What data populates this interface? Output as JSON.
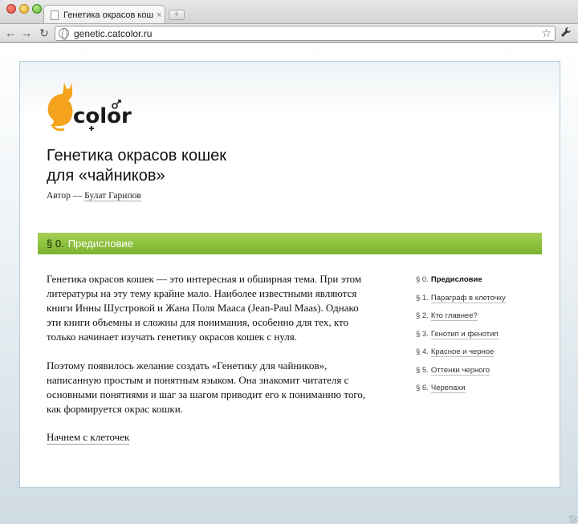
{
  "browser": {
    "tab_title": "Генетика окрасов кошек для «чайников»",
    "tab_close": "×",
    "new_tab": "+",
    "url": "genetic.catcolor.ru",
    "back_glyph": "←",
    "forward_glyph": "→",
    "reload_glyph": "↻",
    "star_glyph": "☆",
    "wrench_glyph": "🔧"
  },
  "site": {
    "logo_text": "color",
    "title_line1": "Генетика окрасов кошек",
    "title_line2": "для «чайников»",
    "author_prefix": "Автор — ",
    "author_name": "Булат Гарипов",
    "brand_color": "#f5a21c"
  },
  "section": {
    "sign": "§ 0.",
    "title": "Предисловие",
    "bar_color": "#8ec13e"
  },
  "content": {
    "paragraph1": "Генетика окрасов кошек — это интересная и обширная тема. При этом литературы на эту тему крайне мало. Наиболее известными являются книги Инны Шустровой и Жана Поля Мааса (Jean-Paul Maas). Однако эти книги объемны и сложны для понимания, особенно для тех, кто только начинает изучать генетику окрасов кошек с нуля.",
    "paragraph2": "Поэтому появилось желание создать «Генетику для чайников», написанную простым и понятным языком. Она знакомит читателя с основными понятиями и шаг за шагом приводит его к пониманию того, как формируется окрас кошки.",
    "next_link": "Начнем с клеточек"
  },
  "toc": [
    {
      "num": "§ 0.",
      "label": "Предисловие",
      "current": true
    },
    {
      "num": "§ 1.",
      "label": "Параграф в клеточку",
      "current": false
    },
    {
      "num": "§ 2.",
      "label": "Кто главнее?",
      "current": false
    },
    {
      "num": "§ 3.",
      "label": "Генотип и фенотип",
      "current": false
    },
    {
      "num": "§ 4.",
      "label": "Красное и черное",
      "current": false
    },
    {
      "num": "§ 5.",
      "label": "Оттенки черного",
      "current": false
    },
    {
      "num": "§ 6.",
      "label": "Черепахи",
      "current": false
    }
  ]
}
